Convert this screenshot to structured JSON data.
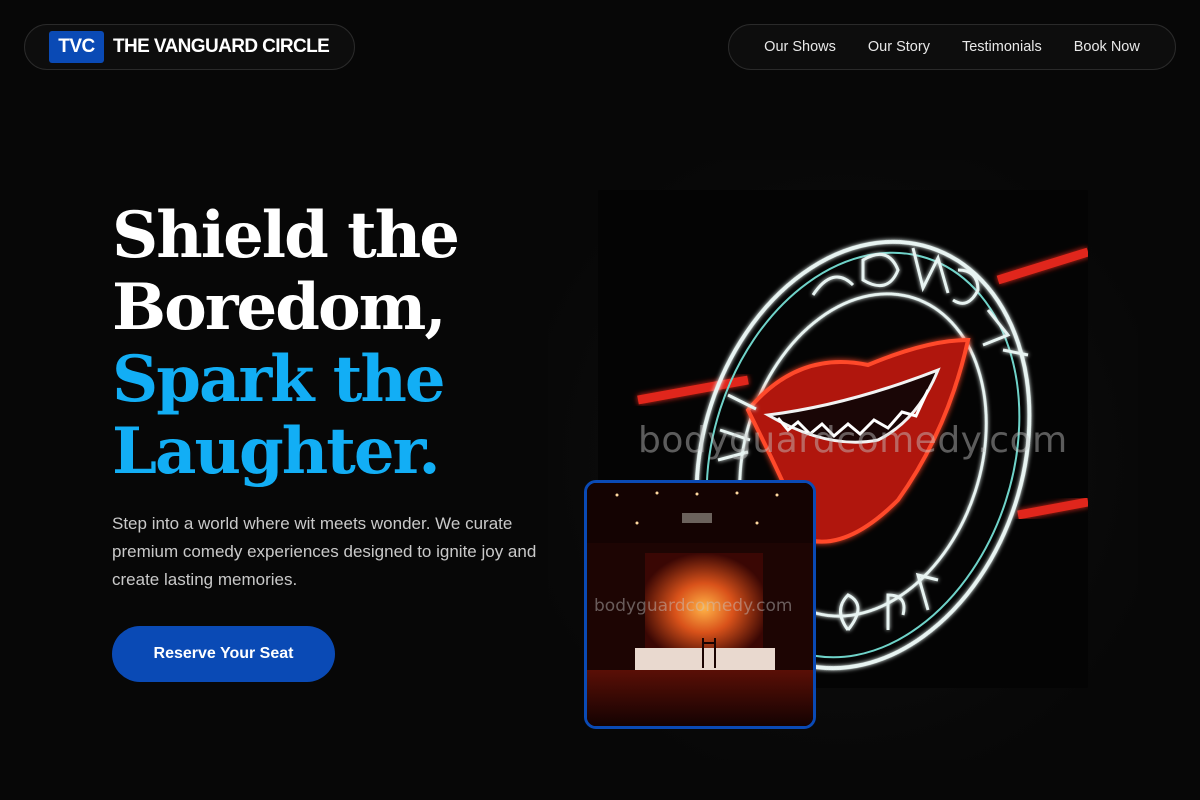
{
  "header": {
    "logo_badge": "TVC",
    "brand_name": "THE VANGUARD CIRCLE",
    "nav": [
      {
        "label": "Our Shows"
      },
      {
        "label": "Our Story"
      },
      {
        "label": "Testimonials"
      },
      {
        "label": "Book Now"
      }
    ]
  },
  "hero": {
    "headline_lines": [
      "Shield the",
      "Boredom,"
    ],
    "headline_accent_lines": [
      "Spark the",
      "Laughter."
    ],
    "lead": "Step into a world where wit meets wonder. We curate premium comedy experiences designed to ignite joy and create lasting memories.",
    "cta_label": "Reserve Your Seat"
  },
  "images": {
    "main_image": {
      "depicts": "neon-comedy-store-sign",
      "watermark": "bodyguardcomedy.com"
    },
    "inset_image": {
      "depicts": "lit-comedy-stage",
      "watermark": "bodyguardcomedy.com"
    }
  },
  "colors": {
    "background": "#070707",
    "brand_blue": "#0a4ab5",
    "accent_cyan": "#12aef5",
    "body_text": "#c9c9c9"
  }
}
